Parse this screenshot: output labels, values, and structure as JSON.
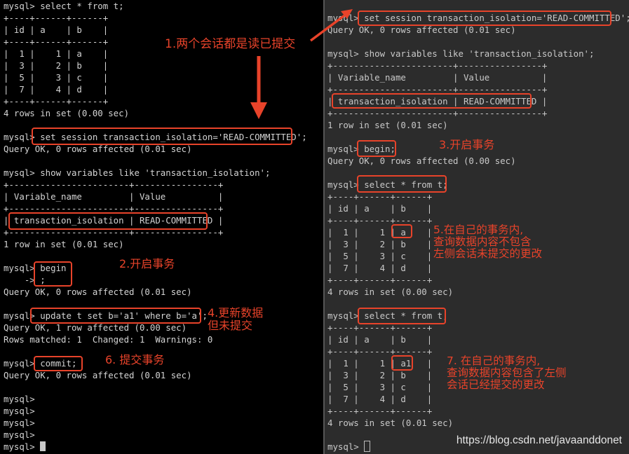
{
  "left_terminal": {
    "lines": [
      "mysql> select * from t;",
      "+----+------+------+",
      "| id | a    | b    |",
      "+----+------+------+",
      "|  1 |    1 | a    |",
      "|  3 |    2 | b    |",
      "|  5 |    3 | c    |",
      "|  7 |    4 | d    |",
      "+----+------+------+",
      "4 rows in set (0.00 sec)",
      "",
      "mysql> set session transaction_isolation='READ-COMMITTED';",
      "Query OK, 0 rows affected (0.01 sec)",
      "",
      "mysql> show variables like 'transaction_isolation';",
      "+-----------------------+----------------+",
      "| Variable_name         | Value          |",
      "+-----------------------+----------------+",
      "| transaction_isolation | READ-COMMITTED |",
      "+-----------------------+----------------+",
      "1 row in set (0.01 sec)",
      "",
      "mysql> begin",
      "    -> ;",
      "Query OK, 0 rows affected (0.01 sec)",
      "",
      "mysql> update t set b='a1' where b='a';",
      "Query OK, 1 row affected (0.00 sec)",
      "Rows matched: 1  Changed: 1  Warnings: 0",
      "",
      "mysql> commit;",
      "Query OK, 0 rows affected (0.01 sec)",
      "",
      "mysql>",
      "mysql>",
      "mysql>",
      "mysql>",
      "mysql> "
    ]
  },
  "right_terminal": {
    "lines": [
      "",
      "mysql> set session transaction_isolation='READ-COMMITTED';",
      "Query OK, 0 rows affected (0.01 sec)",
      "",
      "mysql> show variables like 'transaction_isolation';",
      "+-----------------------+----------------+",
      "| Variable_name         | Value          |",
      "+-----------------------+----------------+",
      "| transaction_isolation | READ-COMMITTED |",
      "+-----------------------+----------------+",
      "1 row in set (0.01 sec)",
      "",
      "mysql> begin;",
      "Query OK, 0 rows affected (0.00 sec)",
      "",
      "mysql> select * from t;",
      "+----+------+------+",
      "| id | a    | b    |",
      "+----+------+------+",
      "|  1 |    1 | a    |",
      "|  3 |    2 | b    |",
      "|  5 |    3 | c    |",
      "|  7 |    4 | d    |",
      "+----+------+------+",
      "4 rows in set (0.00 sec)",
      "",
      "mysql> select * from t;",
      "+----+------+------+",
      "| id | a    | b    |",
      "+----+------+------+",
      "|  1 |    1 | a1   |",
      "|  3 |    2 | b    |",
      "|  5 |    3 | c    |",
      "|  7 |    4 | d    |",
      "+----+------+------+",
      "4 rows in set (0.01 sec)",
      "",
      "mysql> "
    ]
  },
  "annotations": {
    "step1": "1.两个会话都是读已提交",
    "step2": "2.开启事务",
    "step3": "3.开启事务",
    "step4": "4.更新数据\n但未提交",
    "step5": "5.在自己的事务内,\n查询数据内容不包含\n左侧会话未提交的更改",
    "step6": "6. 提交事务",
    "step7": "7. 在自己的事务内,\n查询数据内容包含了左侧\n会话已经提交的更改"
  },
  "watermark": "https://blog.csdn.net/javaanddonet",
  "colors": {
    "annotation": "#e8432a",
    "left_bg": "#000000",
    "right_bg": "#2c2c2c"
  }
}
